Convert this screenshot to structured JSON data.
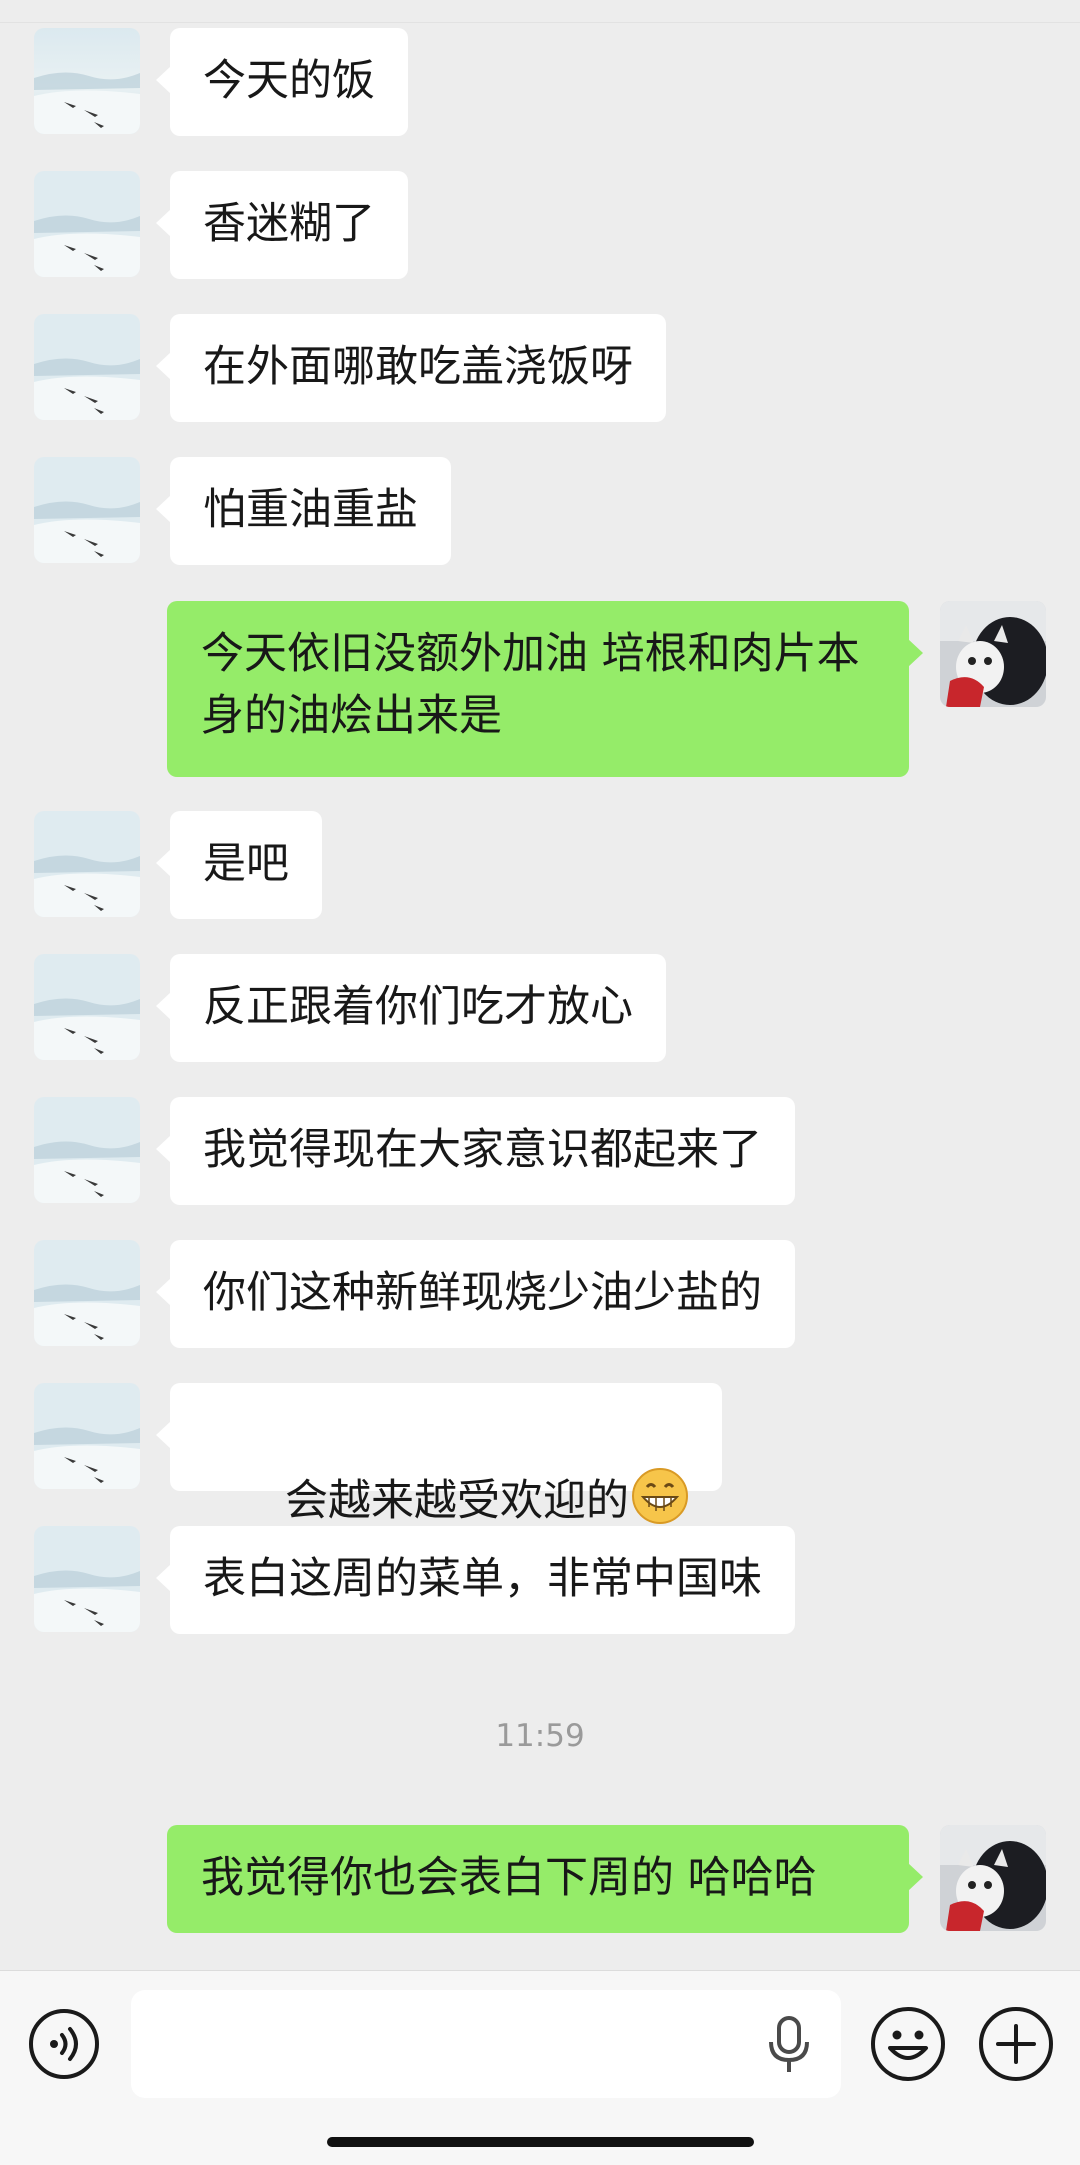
{
  "messages": [
    {
      "side": "in",
      "text": "今天的饭"
    },
    {
      "side": "in",
      "text": "香迷糊了"
    },
    {
      "side": "in",
      "text": "在外面哪敢吃盖浇饭呀"
    },
    {
      "side": "in",
      "text": "怕重油重盐"
    },
    {
      "side": "out",
      "text": "今天依旧没额外加油 培根和肉片本身的油烩出来是"
    },
    {
      "side": "in",
      "text": "是吧"
    },
    {
      "side": "in",
      "text": "反正跟着你们吃才放心"
    },
    {
      "side": "in",
      "text": "我觉得现在大家意识都起来了"
    },
    {
      "side": "in",
      "text": "你们这种新鲜现烧少油少盐的"
    },
    {
      "side": "in",
      "text": "会越来越受欢迎的",
      "emoji": "grinning-emoji"
    },
    {
      "side": "in",
      "text": "表白这周的菜单，非常中国味"
    },
    {
      "side": "out",
      "text": "我觉得你也会表白下周的 哈哈哈"
    }
  ],
  "timestamp": "11:59",
  "input_bar": {
    "text_value": "",
    "icons": [
      "voice-icon",
      "microphone-icon",
      "emoji-icon",
      "plus-icon"
    ]
  },
  "colors": {
    "background": "#ededed",
    "incoming_bubble": "#ffffff",
    "outgoing_bubble": "#95ec69",
    "timestamp_text": "#9a9a9a"
  }
}
